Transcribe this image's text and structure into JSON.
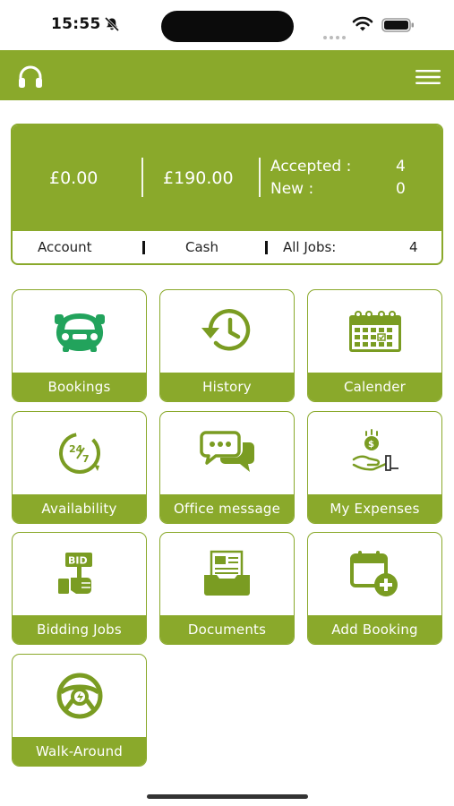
{
  "status_bar": {
    "time": "15:55",
    "icons": [
      "bell-slash-icon",
      "signal-icon",
      "wifi-icon",
      "battery-icon"
    ]
  },
  "header": {
    "left_icon": "headset-icon",
    "right_icon": "hamburger-menu-icon",
    "background": "#8aa92b"
  },
  "summary": {
    "account_amount": "£0.00",
    "cash_amount": "£190.00",
    "accepted_label": "Accepted :",
    "accepted_value": "4",
    "new_label": "New :",
    "new_value": "0",
    "account_label": "Account",
    "cash_label": "Cash",
    "all_jobs_label": "All Jobs:",
    "all_jobs_value": "4"
  },
  "tiles": [
    {
      "label": "Bookings",
      "icon": "car-front-icon"
    },
    {
      "label": "History",
      "icon": "history-clock-icon"
    },
    {
      "label": "Calender",
      "icon": "calendar-icon"
    },
    {
      "label": "Availability",
      "icon": "availability-24-7-icon"
    },
    {
      "label": "Office message",
      "icon": "chat-bubbles-icon"
    },
    {
      "label": "My Expenses",
      "icon": "expenses-hand-coin-icon"
    },
    {
      "label": "Bidding Jobs",
      "icon": "bid-sign-icon"
    },
    {
      "label": "Documents",
      "icon": "documents-folder-icon"
    },
    {
      "label": "Add Booking",
      "icon": "calendar-add-icon"
    },
    {
      "label": "Walk-Around",
      "icon": "steering-wheel-icon"
    }
  ],
  "colors": {
    "accent": "#8aa92b",
    "text_dark": "#222222",
    "white": "#ffffff"
  }
}
